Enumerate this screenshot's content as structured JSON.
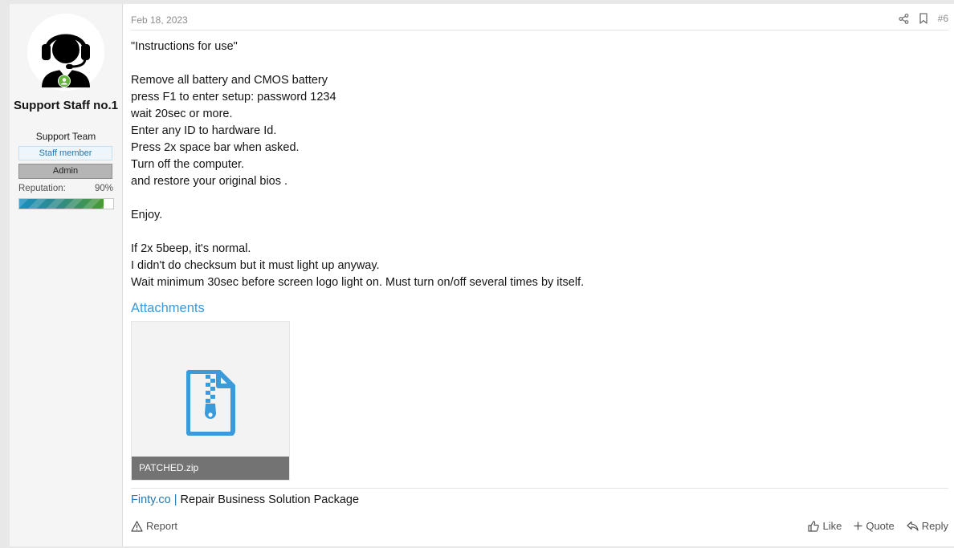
{
  "user": {
    "name": "Support Staff no.1",
    "title": "Support Team",
    "badges": [
      "Staff member",
      "Admin"
    ],
    "reputation_label": "Reputation:",
    "reputation_value": "90%",
    "reputation_fraction": 0.9,
    "online_color": "#63b33b"
  },
  "post": {
    "date": "Feb 18, 2023",
    "number": "#6",
    "lines": [
      "\"Instructions for use\"",
      "",
      "Remove all battery and CMOS battery",
      "press F1 to enter setup: password 1234",
      "wait 20sec or more.",
      "Enter any ID to hardware Id.",
      "Press 2x space bar when asked.",
      "Turn off the computer.",
      "and restore your original bios .",
      "",
      "Enjoy.",
      "",
      "If 2x 5beep, it's normal.",
      "I didn't do checksum but it must light up anyway.",
      "Wait minimum 30sec before screen logo light on. Must turn on/off several times by itself."
    ]
  },
  "attachments": {
    "title": "Attachments",
    "items": [
      {
        "name": "PATCHED.zip",
        "icon": "zip-file-icon"
      }
    ]
  },
  "signature": {
    "link_text": "Finty.co",
    "separator": "|",
    "text": "Repair Business Solution Package"
  },
  "footer": {
    "report": "Report",
    "like": "Like",
    "quote": "Quote",
    "reply": "Reply"
  },
  "colors": {
    "accent": "#3b9ad9",
    "link": "#2577b1",
    "sidebar_bg": "#f5f5f5"
  }
}
